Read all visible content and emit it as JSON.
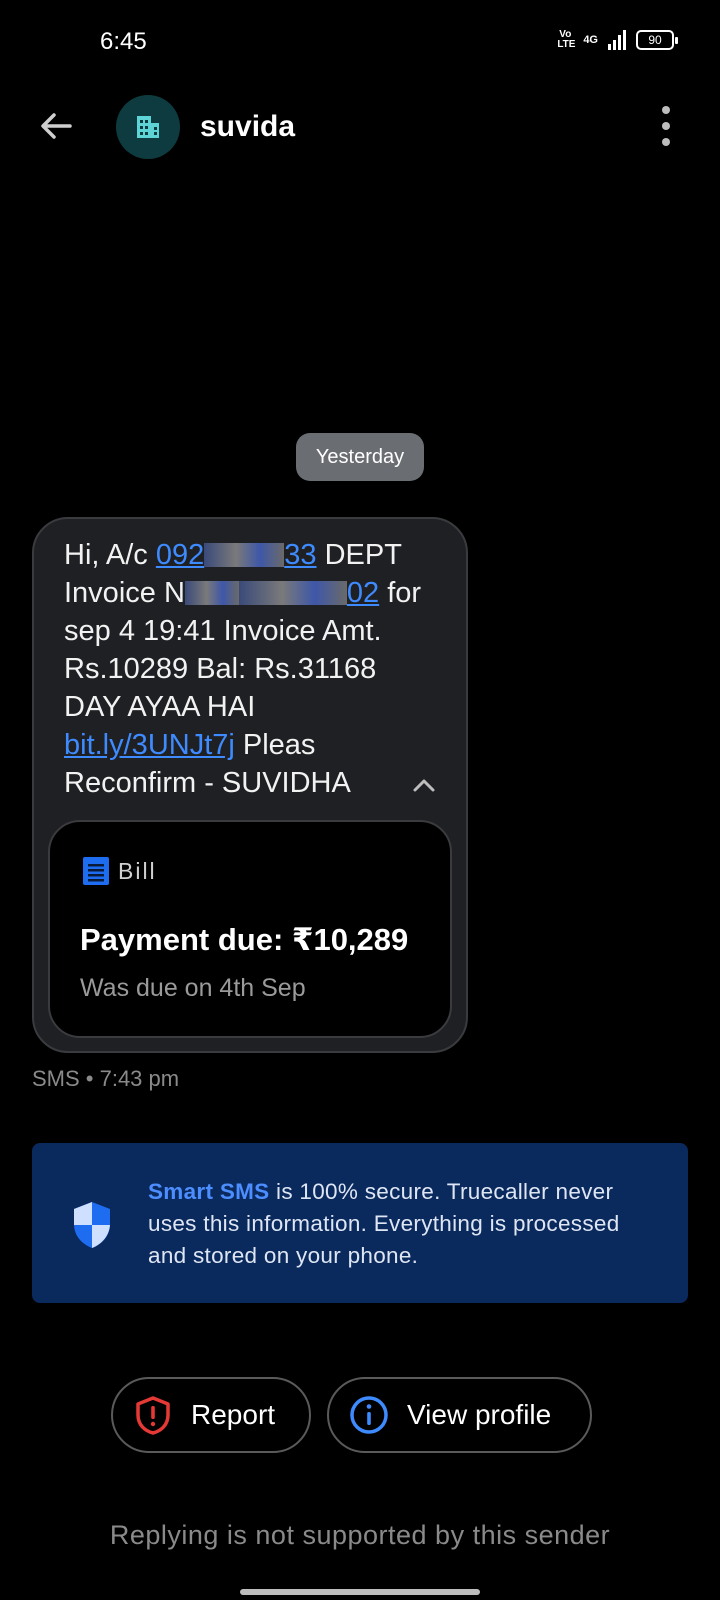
{
  "status_bar": {
    "time": "6:45",
    "volte": "Vo LTE",
    "network": "4G",
    "battery": "90"
  },
  "header": {
    "title": "suvida"
  },
  "thread": {
    "date_chip": "Yesterday",
    "message": {
      "p1": "Hi, A/c ",
      "acct_start": "092",
      "acct_end": "33",
      "p2": " DEPT Invoice N",
      "inv_end": "02",
      "p3": " for sep 4 19:41 Invoice Amt. Rs.10289 Bal: Rs.31168 DAY AYAA HAI ",
      "url": "bit.ly/3UNJt7j",
      "p4": " Pleas Reconfirm - SUVIDHA"
    },
    "bill_card": {
      "label": "Bill",
      "amount": "Payment due: ₹10,289",
      "subtext": "Was due on 4th Sep"
    },
    "meta": "SMS • 7:43 pm"
  },
  "banner": {
    "highlight": "Smart SMS",
    "text": " is 100% secure. Truecaller never uses this information. Everything is processed and stored on your phone."
  },
  "actions": {
    "report": "Report",
    "view_profile": "View profile"
  },
  "footer": "Replying is not supported by this sender",
  "colors": {
    "accent": "#3e8bff",
    "banner_bg": "#0a2a5e",
    "report_red": "#e53935"
  }
}
